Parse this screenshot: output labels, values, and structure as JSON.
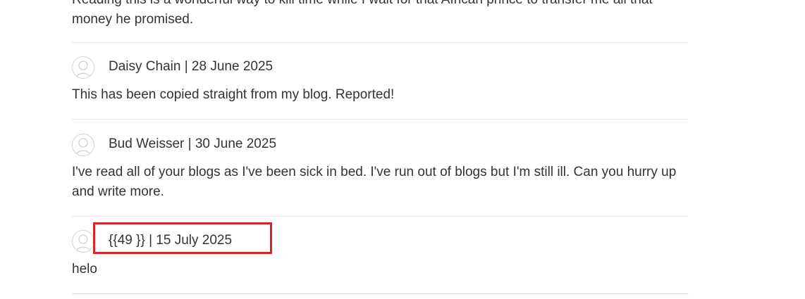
{
  "comments": [
    {
      "text": "Reading this is a wonderful way to kill time while I wait for that African prince to transfer me all that money he promised."
    },
    {
      "author": "Daisy Chain",
      "date": "28 June 2025",
      "meta": "Daisy Chain | 28 June 2025",
      "text": "This has been copied straight from my blog. Reported!"
    },
    {
      "author": "Bud Weisser",
      "date": "30 June 2025",
      "meta": "Bud Weisser | 30 June 2025",
      "text": "I've read all of your blogs as I've been sick in bed. I've run out of blogs but I'm still ill. Can you hurry up and write more."
    },
    {
      "author": "{{49 }}",
      "date": "15 July 2025",
      "meta": "{{49 }} | 15 July 2025",
      "text": "helo"
    }
  ],
  "annotation": {
    "color": "#d9232a"
  }
}
